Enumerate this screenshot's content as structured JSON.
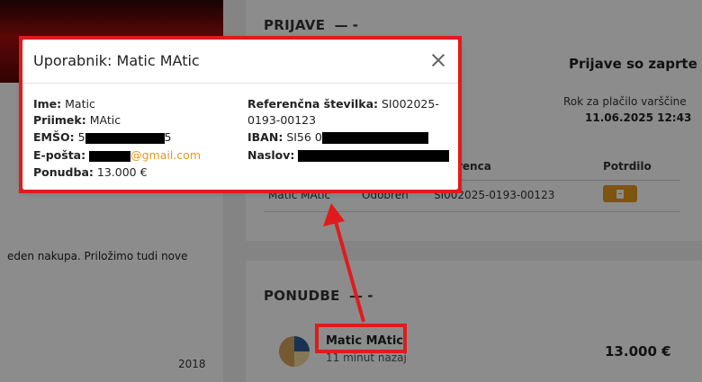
{
  "background": {
    "left_text": "eden nakupa. Priložimo tudi nove",
    "left_year": "2018",
    "prijave": {
      "title": "PRIJAVE",
      "status": "Prijave so zaprte",
      "due_label": "Rok za plačilo varščine",
      "due_value": "11.06.2025 12:43",
      "col_ref": "renca",
      "col_confirm": "Potrdilo",
      "row": {
        "name": "Matic MAtic",
        "status": "Odobren",
        "ref": "SI002025-0193-00123"
      }
    },
    "ponudbe": {
      "title": "PONUDBE",
      "bidder": "Matic MAtic",
      "time": "11 minut nazaj",
      "amount": "13.000 €"
    }
  },
  "modal": {
    "title": "Uporabnik: Matic MAtic",
    "fields": {
      "ime_label": "Ime:",
      "ime": "Matic",
      "priimek_label": "Priimek:",
      "priimek": "MAtic",
      "emso_label": "EMŠO:",
      "emso_start": "5",
      "emso_end": "5",
      "eposta_label": "E-pošta:",
      "eposta_domain": "@gmail.com",
      "ponudba_label": "Ponudba:",
      "ponudba": "13.000 €",
      "ref_label": "Referenčna številka:",
      "ref_line1": "SI002025-",
      "ref_line2": "0193-00123",
      "iban_label": "IBAN:",
      "iban_start": "SI56 0",
      "naslov_label": "Naslov:"
    }
  },
  "colors": {
    "accent": "#e39a1e",
    "annotation": "#e01b1b"
  },
  "icons": {
    "close": "close-icon",
    "pdf": "pdf-icon",
    "avatar": "avatar"
  }
}
